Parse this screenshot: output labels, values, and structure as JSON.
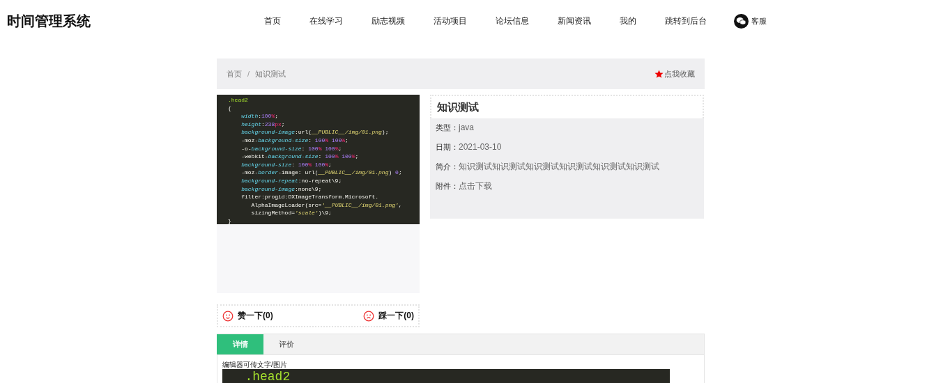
{
  "header": {
    "site_title": "时间管理系统",
    "nav": [
      {
        "label": "首页"
      },
      {
        "label": "在线学习"
      },
      {
        "label": "励志视频"
      },
      {
        "label": "活动项目"
      },
      {
        "label": "论坛信息"
      },
      {
        "label": "新闻资讯"
      },
      {
        "label": "我的"
      },
      {
        "label": "跳转到后台"
      }
    ],
    "service": {
      "label": "客服"
    }
  },
  "breadcrumb": {
    "items": [
      "首页",
      "知识测试"
    ],
    "separator": "/",
    "favorite": "点我收藏"
  },
  "cover": {
    "lines": [
      {
        "kind": "selector",
        "segments": [
          {
            "kind": "sel",
            "text": ".head2"
          }
        ]
      },
      {
        "kind": "brace",
        "segments": [
          {
            "kind": "plain",
            "text": "{"
          }
        ]
      },
      {
        "kind": "decl",
        "segments": [
          {
            "kind": "prop",
            "text": "width"
          },
          {
            "kind": "plain",
            "text": ":"
          },
          {
            "kind": "num",
            "text": "100"
          },
          {
            "kind": "unit",
            "text": "%"
          },
          {
            "kind": "plain",
            "text": ";"
          }
        ]
      },
      {
        "kind": "decl",
        "segments": [
          {
            "kind": "prop",
            "text": "height"
          },
          {
            "kind": "plain",
            "text": ":"
          },
          {
            "kind": "num",
            "text": "238"
          },
          {
            "kind": "unit",
            "text": "px"
          },
          {
            "kind": "plain",
            "text": ";"
          }
        ]
      },
      {
        "kind": "decl",
        "segments": [
          {
            "kind": "prop",
            "text": "background-image"
          },
          {
            "kind": "plain",
            "text": ":url("
          },
          {
            "kind": "str",
            "text": "__PUBLIC__/img/01.png"
          },
          {
            "kind": "plain",
            "text": ");"
          }
        ]
      },
      {
        "kind": "decl",
        "segments": [
          {
            "kind": "plain",
            "text": "-moz-"
          },
          {
            "kind": "prop",
            "text": "background-size"
          },
          {
            "kind": "plain",
            "text": ": "
          },
          {
            "kind": "num",
            "text": "100"
          },
          {
            "kind": "unit",
            "text": "% "
          },
          {
            "kind": "num",
            "text": "100"
          },
          {
            "kind": "unit",
            "text": "%"
          },
          {
            "kind": "plain",
            "text": ";"
          }
        ]
      },
      {
        "kind": "decl",
        "segments": [
          {
            "kind": "plain",
            "text": "-o-"
          },
          {
            "kind": "prop",
            "text": "background-size"
          },
          {
            "kind": "plain",
            "text": ": "
          },
          {
            "kind": "num",
            "text": "100"
          },
          {
            "kind": "unit",
            "text": "% "
          },
          {
            "kind": "num",
            "text": "100"
          },
          {
            "kind": "unit",
            "text": "%"
          },
          {
            "kind": "plain",
            "text": ";"
          }
        ]
      },
      {
        "kind": "decl",
        "segments": [
          {
            "kind": "plain",
            "text": "-webkit-"
          },
          {
            "kind": "prop",
            "text": "background-size"
          },
          {
            "kind": "plain",
            "text": ": "
          },
          {
            "kind": "num",
            "text": "100"
          },
          {
            "kind": "unit",
            "text": "% "
          },
          {
            "kind": "num",
            "text": "100"
          },
          {
            "kind": "unit",
            "text": "%"
          },
          {
            "kind": "plain",
            "text": ";"
          }
        ]
      },
      {
        "kind": "decl",
        "segments": [
          {
            "kind": "prop",
            "text": "background-size"
          },
          {
            "kind": "plain",
            "text": ": "
          },
          {
            "kind": "num",
            "text": "100"
          },
          {
            "kind": "unit",
            "text": "% "
          },
          {
            "kind": "num",
            "text": "100"
          },
          {
            "kind": "unit",
            "text": "%"
          },
          {
            "kind": "plain",
            "text": ";"
          }
        ]
      },
      {
        "kind": "decl",
        "segments": [
          {
            "kind": "plain",
            "text": "-moz-"
          },
          {
            "kind": "prop",
            "text": "border"
          },
          {
            "kind": "plain",
            "text": "-image: url("
          },
          {
            "kind": "str",
            "text": "__PUBLIC__/img/01.png"
          },
          {
            "kind": "plain",
            "text": ") "
          },
          {
            "kind": "num",
            "text": "0"
          },
          {
            "kind": "plain",
            "text": ";"
          }
        ]
      },
      {
        "kind": "decl",
        "segments": [
          {
            "kind": "prop",
            "text": "background-repeat"
          },
          {
            "kind": "plain",
            "text": ":no-repeat\\9;"
          }
        ]
      },
      {
        "kind": "decl",
        "segments": [
          {
            "kind": "prop",
            "text": "background-image"
          },
          {
            "kind": "plain",
            "text": ":none\\9;"
          }
        ]
      },
      {
        "kind": "decl",
        "segments": [
          {
            "kind": "plain",
            "text": "filter:progid:DXImageTransform.Microsoft."
          }
        ]
      },
      {
        "kind": "cont",
        "segments": [
          {
            "kind": "plain",
            "text": "AlphaImageLoader(src="
          },
          {
            "kind": "str",
            "text": "'__PUBLIC__/img/01.png'"
          },
          {
            "kind": "plain",
            "text": ","
          }
        ]
      },
      {
        "kind": "cont",
        "segments": [
          {
            "kind": "plain",
            "text": "sizingMethod="
          },
          {
            "kind": "str",
            "text": "'scale'"
          },
          {
            "kind": "plain",
            "text": ")\\9;"
          }
        ]
      },
      {
        "kind": "brace",
        "segments": [
          {
            "kind": "plain",
            "text": "}"
          }
        ]
      }
    ]
  },
  "info": {
    "title": "知识测试",
    "fields": [
      {
        "label": "类型：",
        "value": "java"
      },
      {
        "label": "日期：",
        "value": "2021-03-10"
      },
      {
        "label": "简介：",
        "value": "知识测试知识测试知识测试知识测试知识测试知识测试"
      },
      {
        "label": "附件：",
        "value": "点击下载"
      }
    ]
  },
  "votes": [
    {
      "kind": "like",
      "label": "赞一下(0)"
    },
    {
      "kind": "dislike",
      "label": "踩一下(0)"
    }
  ],
  "tabs": [
    {
      "label": "详情",
      "selected": true
    },
    {
      "label": "评价",
      "selected": false
    }
  ],
  "detail": {
    "text": "编辑器可传文字/图片",
    "image": {
      "lines": [
        {
          "kind": "selector",
          "segments": [
            {
              "kind": "sel",
              "text": ".head2"
            }
          ]
        }
      ]
    }
  }
}
